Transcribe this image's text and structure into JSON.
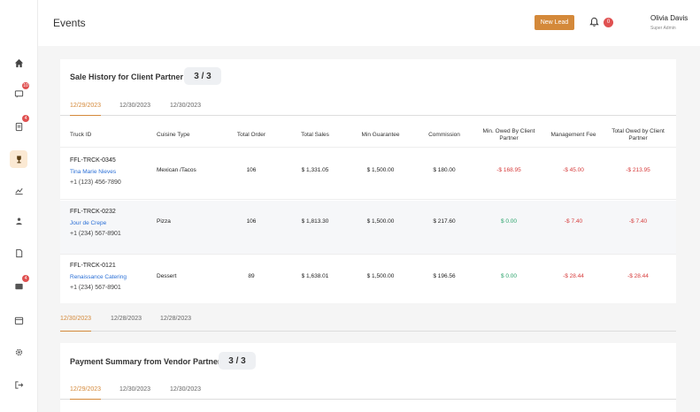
{
  "header": {
    "title": "Events",
    "new_lead_label": "New Lead",
    "notification_count": "0",
    "user_name": "Olivia Davis",
    "user_role": "Super Admin"
  },
  "sidebar": {
    "items": [
      {
        "icon": "home-icon"
      },
      {
        "icon": "chat-icon",
        "badge": "10"
      },
      {
        "icon": "document-icon",
        "badge": "4"
      },
      {
        "icon": "trophy-icon"
      },
      {
        "icon": "chart-icon"
      },
      {
        "icon": "users-icon"
      },
      {
        "icon": "file-icon"
      },
      {
        "icon": "message-icon",
        "badge": "4"
      },
      {
        "icon": "calendar-icon"
      },
      {
        "icon": "gear-icon"
      },
      {
        "icon": "logout-icon"
      }
    ]
  },
  "sale_history": {
    "title": "Sale History for Client Partner",
    "count": "3 / 3",
    "tabs": [
      "12/29/2023",
      "12/30/2023",
      "12/30/2023"
    ],
    "columns": [
      "Truck ID",
      "Cuisine Type",
      "Total Order",
      "Total Sales",
      "Min Guarantee",
      "Commission",
      "Min. Owed By Client Partner",
      "Management Fee",
      "Total Owed by Client Partner"
    ],
    "rows": [
      {
        "truck_id": "FFL-TRCK-0345",
        "name": "Tina Marie Nieves",
        "phone": "+1 (123) 456-7890",
        "cuisine": "Mexican /Tacos",
        "total_order": "106",
        "total_sales": "$ 1,331.05",
        "min_guarantee": "$ 1,500.00",
        "commission": "$ 180.00",
        "min_owed": "-$ 168.95",
        "management_fee": "-$ 45.00",
        "total_owed": "-$ 213.95"
      },
      {
        "truck_id": "FFL-TRCK-0232",
        "name": "Jour de Crepe",
        "phone": "+1 (234) 567-8901",
        "cuisine": "Pizza",
        "total_order": "106",
        "total_sales": "$ 1,813.30",
        "min_guarantee": "$ 1,500.00",
        "commission": "$ 217.60",
        "min_owed": "$ 0.00",
        "management_fee": "-$ 7.40",
        "total_owed": "-$ 7.40"
      },
      {
        "truck_id": "FFL-TRCK-0121",
        "name": "Renaissance Catering",
        "phone": "+1 (234) 567-8901",
        "cuisine": "Dessert",
        "total_order": "89",
        "total_sales": "$ 1,638.01",
        "min_guarantee": "$ 1,500.00",
        "commission": "$ 196.56",
        "min_owed": "$ 0.00",
        "management_fee": "-$ 28.44",
        "total_owed": "-$ 28.44"
      }
    ]
  },
  "date_tabs": [
    "12/30/2023",
    "12/28/2023",
    "12/28/2023"
  ],
  "payment_summary": {
    "title": "Payment Summary from Vendor Partner",
    "count": "3 / 3",
    "tabs": [
      "12/29/2023",
      "12/30/2023",
      "12/30/2023"
    ]
  },
  "colors": {
    "accent": "#d4893a",
    "negative": "#d63b3b",
    "positive": "#2ba36b",
    "link": "#2a6fd6"
  }
}
